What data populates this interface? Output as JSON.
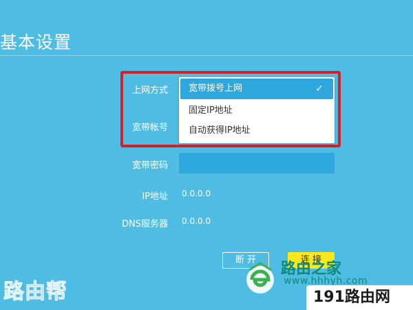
{
  "page": {
    "title": "基本设置"
  },
  "form": {
    "connection_type": {
      "label": "上网方式",
      "options": [
        "宽带拨号上网",
        "固定IP地址",
        "自动获得IP地址"
      ],
      "selected_index": 0,
      "check_glyph": "✓"
    },
    "account": {
      "label": "宽带帐号"
    },
    "password": {
      "label": "宽带密码",
      "value": ""
    },
    "ip": {
      "label": "IP地址",
      "value": "0.0.0.0"
    },
    "dns": {
      "label": "DNS服务器",
      "value": "0.0.0.0"
    }
  },
  "buttons": {
    "disconnect": "断 开",
    "connect": "连 接"
  },
  "watermarks": {
    "left": "路由帮",
    "brand": "路由之家",
    "url": "www.hhhyh.com",
    "badge": "191路由网"
  },
  "colors": {
    "background": "#4fbde3",
    "highlight": "#d62027",
    "selected_option": "#2ea8dc",
    "connect_button": "#ffe81a"
  }
}
